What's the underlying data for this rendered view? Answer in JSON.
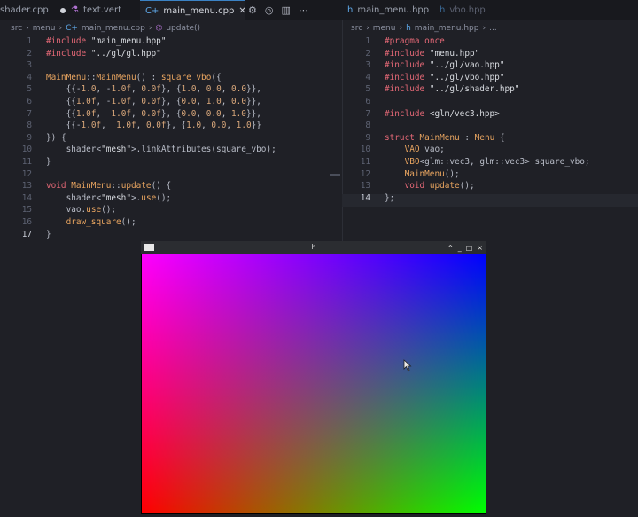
{
  "tabs": [
    {
      "label": "shader.cpp",
      "modified": true
    },
    {
      "label": "text.vert"
    },
    {
      "label": "main_menu.cpp",
      "active": true
    },
    {
      "label": "main_menu.hpp"
    },
    {
      "label": "vbo.hpp"
    }
  ],
  "left_breadcrumb": [
    "src",
    "menu",
    "main_menu.cpp",
    "update()"
  ],
  "right_breadcrumb": [
    "src",
    "menu",
    "main_menu.hpp",
    "..."
  ],
  "left_editor": {
    "line_numbers": [
      "1",
      "2",
      "3",
      "4",
      "5",
      "6",
      "7",
      "8",
      "9",
      "10",
      "11",
      "12",
      "13",
      "14",
      "15",
      "16",
      "17"
    ],
    "current_line": "17",
    "lines": [
      "#include \"main_menu.hpp\"",
      "#include \"../gl/gl.hpp\"",
      "",
      "MainMenu::MainMenu() : square_vbo({",
      "    {{-1.0, -1.0f, 0.0f}, {1.0, 0.0, 0.0}},",
      "    {{1.0f, -1.0f, 0.0f}, {0.0, 1.0, 0.0}},",
      "    {{1.0f,  1.0f, 0.0f}, {0.0, 0.0, 1.0}},",
      "    {{-1.0f,  1.0f, 0.0f}, {1.0, 0.0, 1.0}}",
      "}) {",
      "    shader<\"mesh\">.linkAttributes(square_vbo);",
      "}",
      "",
      "void MainMenu::update() {",
      "    shader<\"mesh\">.use();",
      "    vao.use();",
      "    draw_square();",
      "}"
    ]
  },
  "right_editor": {
    "line_numbers": [
      "1",
      "2",
      "3",
      "4",
      "5",
      "6",
      "7",
      "8",
      "9",
      "10",
      "11",
      "12",
      "13",
      "14"
    ],
    "current_line": "14",
    "lines": [
      "#pragma once",
      "#include \"menu.hpp\"",
      "#include \"../gl/vao.hpp\"",
      "#include \"../gl/vbo.hpp\"",
      "#include \"../gl/shader.hpp\"",
      "",
      "#include <glm/vec3.hpp>",
      "",
      "struct MainMenu : Menu {",
      "    VAO vao;",
      "    VBO<glm::vec3, glm::vec3> square_vbo;",
      "    MainMenu();",
      "    void update();",
      "};"
    ]
  },
  "app_window": {
    "title": "h",
    "controls": [
      "^",
      "_",
      "□",
      "×"
    ],
    "corner_colors": {
      "top_left": "#ff00ff",
      "top_right": "#0000ff",
      "bottom_left": "#ff0000",
      "bottom_right": "#00ff00"
    }
  }
}
